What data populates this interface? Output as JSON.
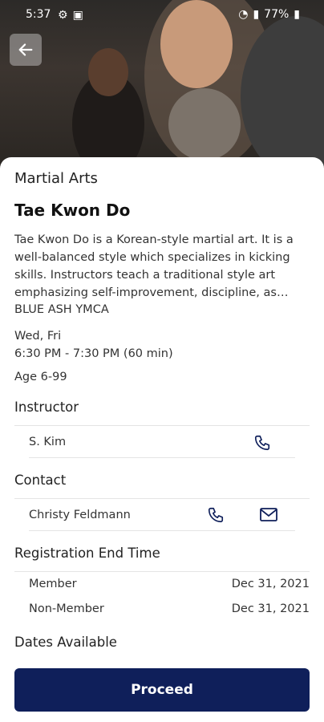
{
  "status_bar": {
    "time": "5:37",
    "battery": "77%"
  },
  "program": {
    "category": "Martial Arts",
    "title": "Tae Kwon Do",
    "description": "Tae Kwon Do is a Korean-style martial art. It is a well-balanced style which specializes in kicking skills. Instructors teach a traditional style art emphasizing self-improvement, discipline, as wel...",
    "location": "BLUE ASH YMCA",
    "days": "Wed, Fri",
    "time": "6:30 PM - 7:30 PM (60 min)",
    "age": "Age 6-99"
  },
  "instructor": {
    "heading": "Instructor",
    "name": "S. Kim"
  },
  "contact": {
    "heading": "Contact",
    "name": "Christy Feldmann"
  },
  "registration": {
    "heading": "Registration End Time",
    "rows": [
      {
        "label": "Member",
        "date": "Dec 31, 2021"
      },
      {
        "label": "Non-Member",
        "date": "Dec 31, 2021"
      }
    ]
  },
  "dates": {
    "heading": "Dates Available"
  },
  "cta": {
    "label": "Proceed"
  },
  "colors": {
    "primary": "#0f1f5a",
    "icon": "#0f1f5a"
  }
}
